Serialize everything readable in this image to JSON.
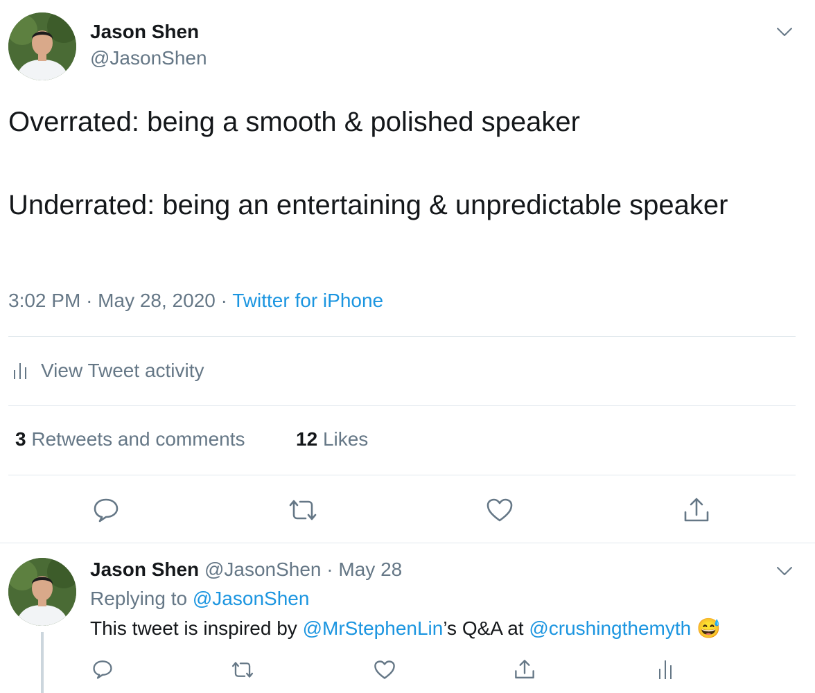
{
  "tweet": {
    "author_name": "Jason Shen",
    "author_handle": "@JasonShen",
    "text": "Overrated: being a smooth & polished speaker\n\nUnderrated: being an entertaining & unpredictable speaker",
    "time": "3:02 PM",
    "date": "May 28, 2020",
    "separator": "·",
    "source": "Twitter for iPhone"
  },
  "activity": {
    "label": "View Tweet activity"
  },
  "stats": {
    "retweets_count": "3",
    "retweets_label": "Retweets and comments",
    "likes_count": "12",
    "likes_label": "Likes"
  },
  "icons": {
    "chevron": "chevron-down-icon",
    "reply": "reply-icon",
    "retweet": "retweet-icon",
    "like": "heart-icon",
    "share": "share-icon",
    "analytics": "analytics-icon"
  },
  "reply": {
    "author_name": "Jason Shen",
    "author_handle": "@JasonShen",
    "separator": "·",
    "date": "May 28",
    "replying_prefix": "Replying to",
    "replying_to": "@JasonShen",
    "text_1": "This tweet is inspired by",
    "mention_1": "@MrStephenLin",
    "text_2": "’s Q&A at",
    "mention_2": "@crushingthemyth",
    "emoji": "😅"
  },
  "colors": {
    "link": "#1b95e0",
    "secondary": "#657786",
    "primary_text": "#14171a",
    "divider": "#e1e8ed"
  }
}
